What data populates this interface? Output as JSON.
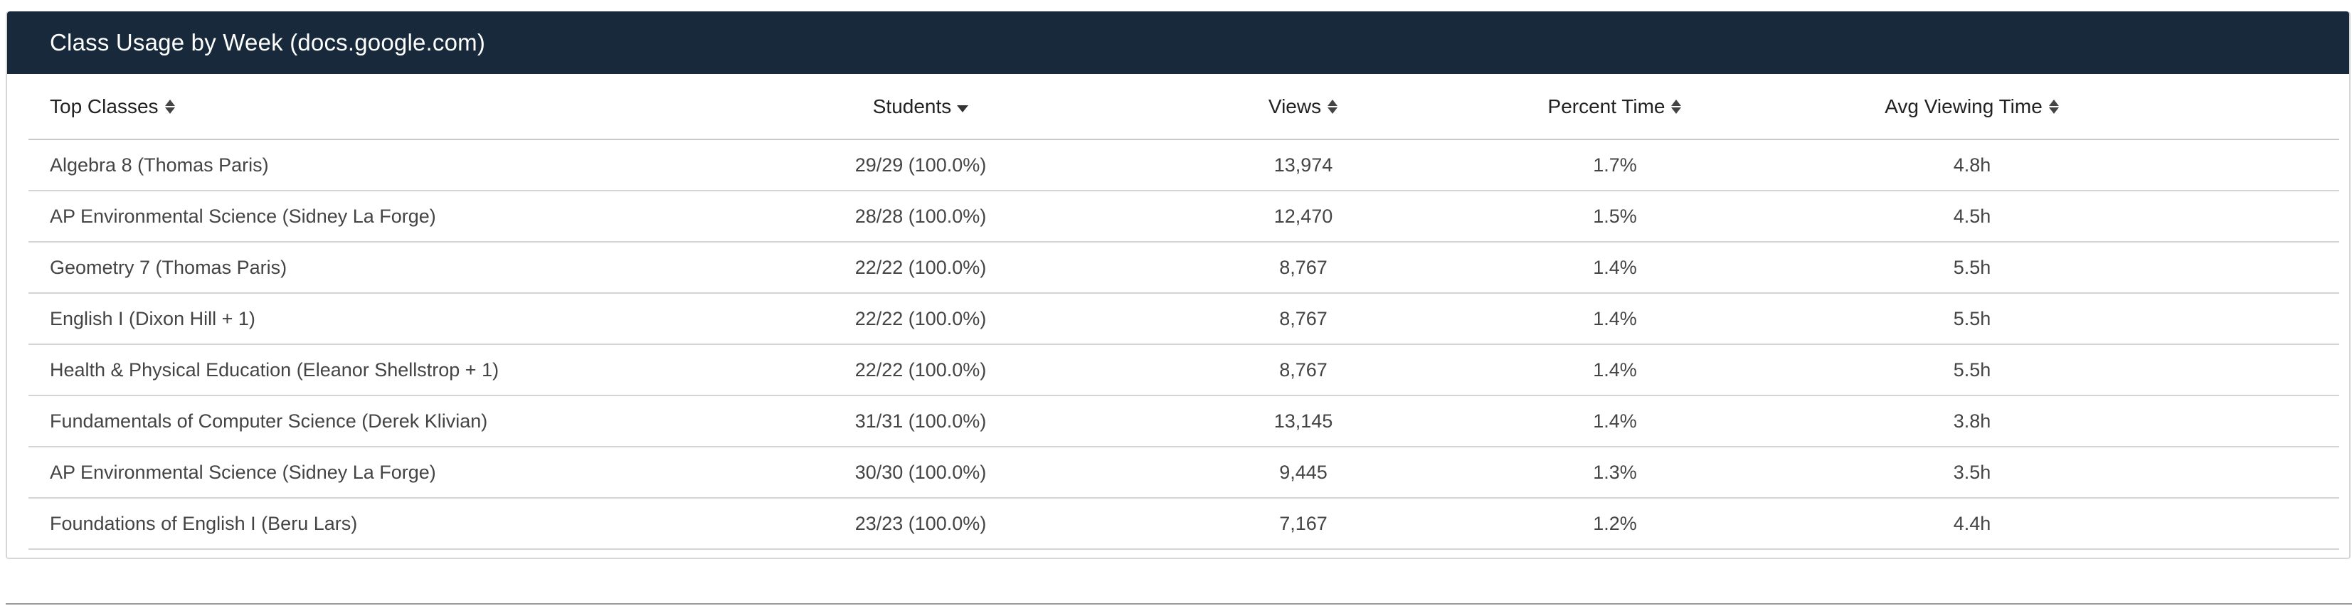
{
  "card": {
    "title": "Class Usage by Week (docs.google.com)"
  },
  "table": {
    "columns": [
      {
        "key": "class",
        "label": "Top Classes",
        "sort": "both"
      },
      {
        "key": "students",
        "label": "Students",
        "sort": "desc"
      },
      {
        "key": "views",
        "label": "Views",
        "sort": "both"
      },
      {
        "key": "percent",
        "label": "Percent Time",
        "sort": "both"
      },
      {
        "key": "avg",
        "label": "Avg Viewing Time",
        "sort": "both"
      }
    ],
    "rows": [
      {
        "class": "Algebra 8 (Thomas Paris)",
        "students": "29/29 (100.0%)",
        "views": "13,974",
        "percent": "1.7%",
        "avg": "4.8h"
      },
      {
        "class": "AP Environmental Science (Sidney La Forge)",
        "students": "28/28 (100.0%)",
        "views": "12,470",
        "percent": "1.5%",
        "avg": "4.5h"
      },
      {
        "class": "Geometry 7 (Thomas Paris)",
        "students": "22/22 (100.0%)",
        "views": "8,767",
        "percent": "1.4%",
        "avg": "5.5h"
      },
      {
        "class": "English I (Dixon Hill + 1)",
        "students": "22/22 (100.0%)",
        "views": "8,767",
        "percent": "1.4%",
        "avg": "5.5h"
      },
      {
        "class": "Health & Physical Education (Eleanor Shellstrop + 1)",
        "students": "22/22 (100.0%)",
        "views": "8,767",
        "percent": "1.4%",
        "avg": "5.5h"
      },
      {
        "class": "Fundamentals of Computer Science (Derek Klivian)",
        "students": "31/31 (100.0%)",
        "views": "13,145",
        "percent": "1.4%",
        "avg": "3.8h"
      },
      {
        "class": "AP Environmental Science (Sidney La Forge)",
        "students": "30/30 (100.0%)",
        "views": "9,445",
        "percent": "1.3%",
        "avg": "3.5h"
      },
      {
        "class": "Foundations of English I (Beru Lars)",
        "students": "23/23 (100.0%)",
        "views": "7,167",
        "percent": "1.2%",
        "avg": "4.4h"
      }
    ]
  }
}
